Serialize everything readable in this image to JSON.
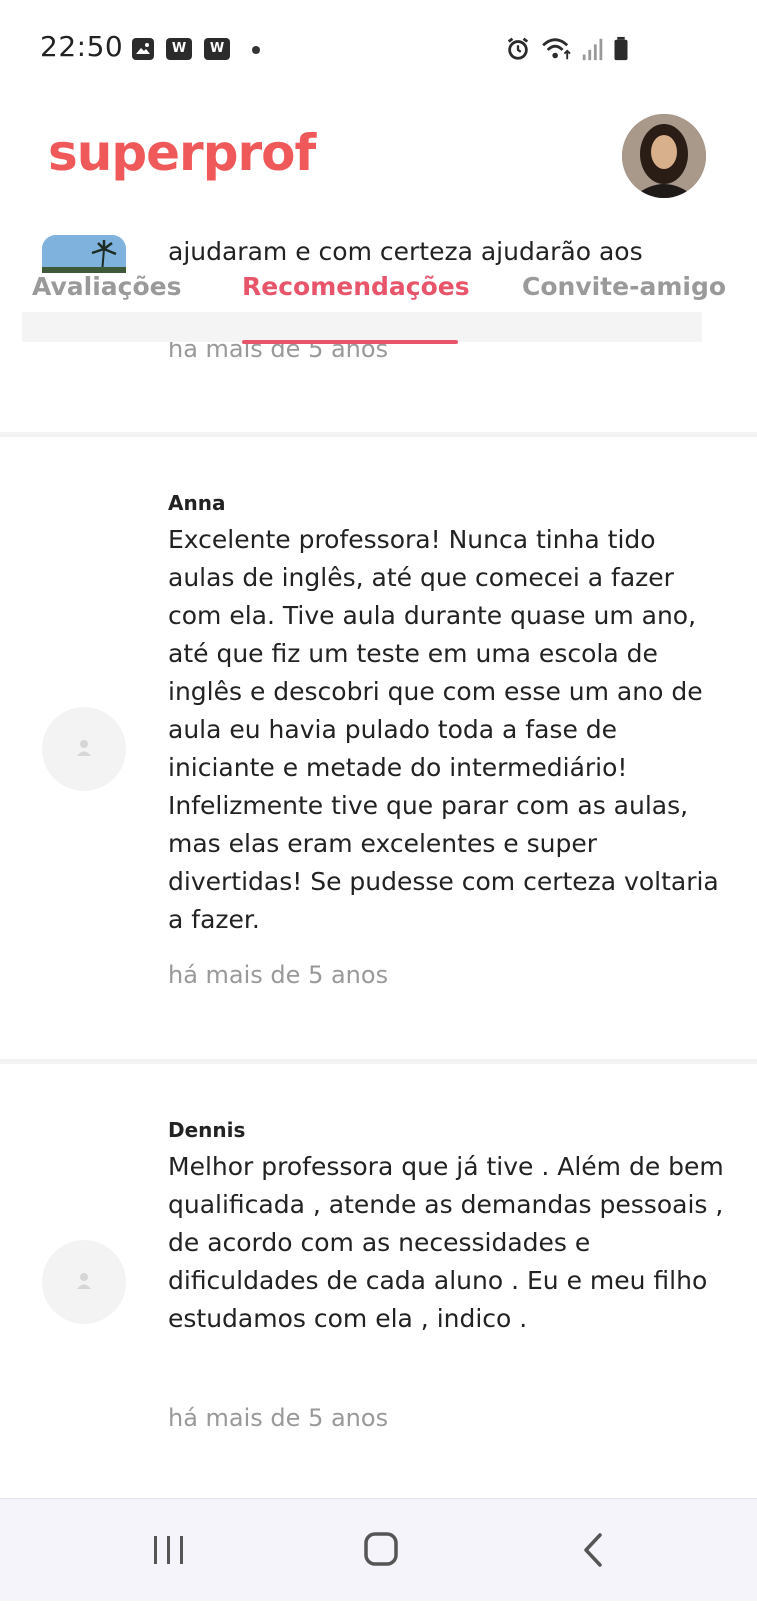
{
  "status_bar": {
    "time": "22:50",
    "icons": [
      "image-icon",
      "w-app-icon",
      "w-app-icon",
      "dot-icon",
      "alarm-icon",
      "wifi-icon",
      "signal-icon",
      "battery-icon"
    ],
    "w_label": "W"
  },
  "header": {
    "logo": "superprof",
    "brand_color": "#f0595a"
  },
  "previous_review": {
    "text": "ajudaram e com certeza ajudarão aos",
    "date": "há mais de 5 anos"
  },
  "tabs": [
    {
      "label": "Avaliações",
      "active": false
    },
    {
      "label": "Recomendações",
      "active": true
    },
    {
      "label": "Convite-amigo",
      "active": false
    }
  ],
  "reviews": [
    {
      "author": "Anna",
      "text": "Excelente professora! Nunca tinha tido aulas de inglês, até que comecei a fazer com ela. Tive aula durante quase um ano, até que fiz um teste em uma escola de inglês e descobri que com esse um ano de aula eu havia pulado toda a fase de iniciante e metade do intermediário! Infelizmente tive que parar com as aulas, mas elas eram excelentes e super divertidas! Se pudesse com certeza voltaria a fazer.",
      "date": "há mais de 5 anos"
    },
    {
      "author": "Dennis",
      "text": "Melhor professora que já tive . Além de bem qualificada , atende as demandas pessoais , de acordo com as necessidades e dificuldades de cada aluno . Eu e meu filho estudamos com ela , indico .",
      "date": "há mais de 5 anos"
    }
  ],
  "nav_bar": {
    "buttons": [
      "recent-apps-icon",
      "home-icon",
      "back-icon"
    ]
  },
  "colors": {
    "accent": "#e8546a",
    "muted_text": "#999999"
  }
}
